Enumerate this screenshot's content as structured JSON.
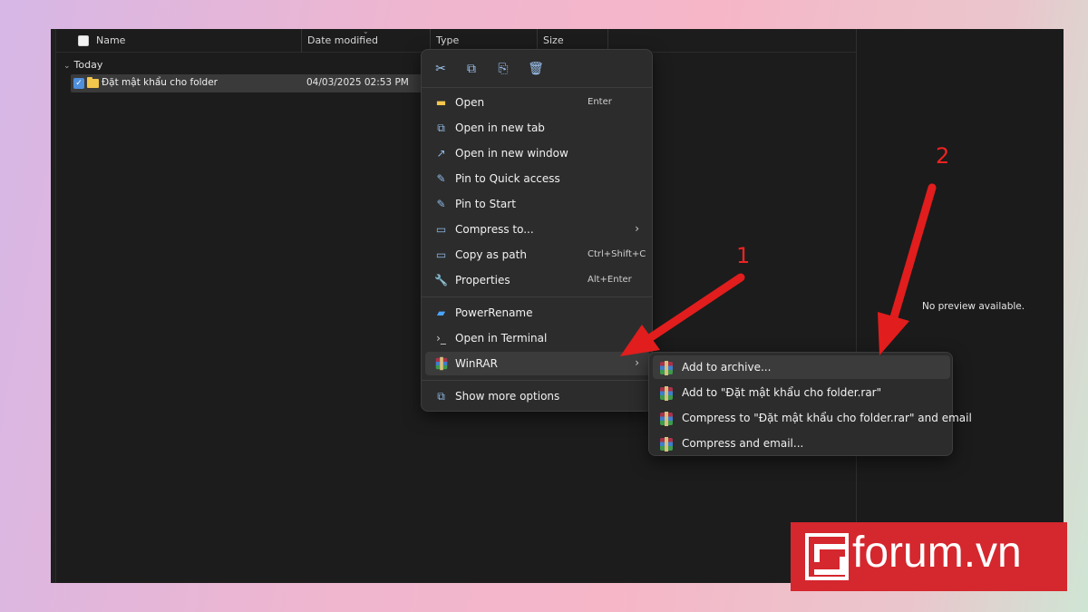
{
  "explorer": {
    "columns": {
      "name": "Name",
      "date": "Date modified",
      "type": "Type",
      "size": "Size"
    },
    "group_label": "Today",
    "row": {
      "name": "Đặt mật khẩu cho folder",
      "date": "04/03/2025 02:53 PM"
    },
    "preview_text": "No preview available."
  },
  "context_menu": {
    "icon_bar": [
      "cut-icon",
      "copy-icon",
      "rename-icon",
      "delete-icon"
    ],
    "items": [
      {
        "label": "Open",
        "shortcut": "Enter",
        "icon": "folder-icon"
      },
      {
        "label": "Open in new tab",
        "shortcut": "",
        "icon": "new-tab-icon"
      },
      {
        "label": "Open in new window",
        "shortcut": "",
        "icon": "new-window-icon"
      },
      {
        "label": "Pin to Quick access",
        "shortcut": "",
        "icon": "pin-icon"
      },
      {
        "label": "Pin to Start",
        "shortcut": "",
        "icon": "pin-icon"
      },
      {
        "label": "Compress to...",
        "shortcut": "",
        "icon": "compress-icon",
        "submenu": true
      },
      {
        "label": "Copy as path",
        "shortcut": "Ctrl+Shift+C",
        "icon": "copy-path-icon"
      },
      {
        "label": "Properties",
        "shortcut": "Alt+Enter",
        "icon": "wrench-icon"
      },
      {
        "label": "PowerRename",
        "shortcut": "",
        "icon": "powerrename-icon"
      },
      {
        "label": "Open in Terminal",
        "shortcut": "",
        "icon": "terminal-icon"
      },
      {
        "label": "WinRAR",
        "shortcut": "",
        "icon": "winrar-icon",
        "submenu": true
      },
      {
        "label": "Show more options",
        "shortcut": "",
        "icon": "more-options-icon"
      }
    ]
  },
  "submenu": {
    "items": [
      {
        "label": "Add to archive..."
      },
      {
        "label": "Add to \"Đặt mật khẩu cho folder.rar\""
      },
      {
        "label": "Compress to \"Đặt mật khẩu cho folder.rar\" and email"
      },
      {
        "label": "Compress and email..."
      }
    ]
  },
  "annotations": {
    "one": "1",
    "two": "2"
  },
  "watermark": "forum.vn",
  "colors": {
    "arrow": "#e11d1d",
    "logo_bg": "#d5272e",
    "accent": "#4f8fdc"
  }
}
